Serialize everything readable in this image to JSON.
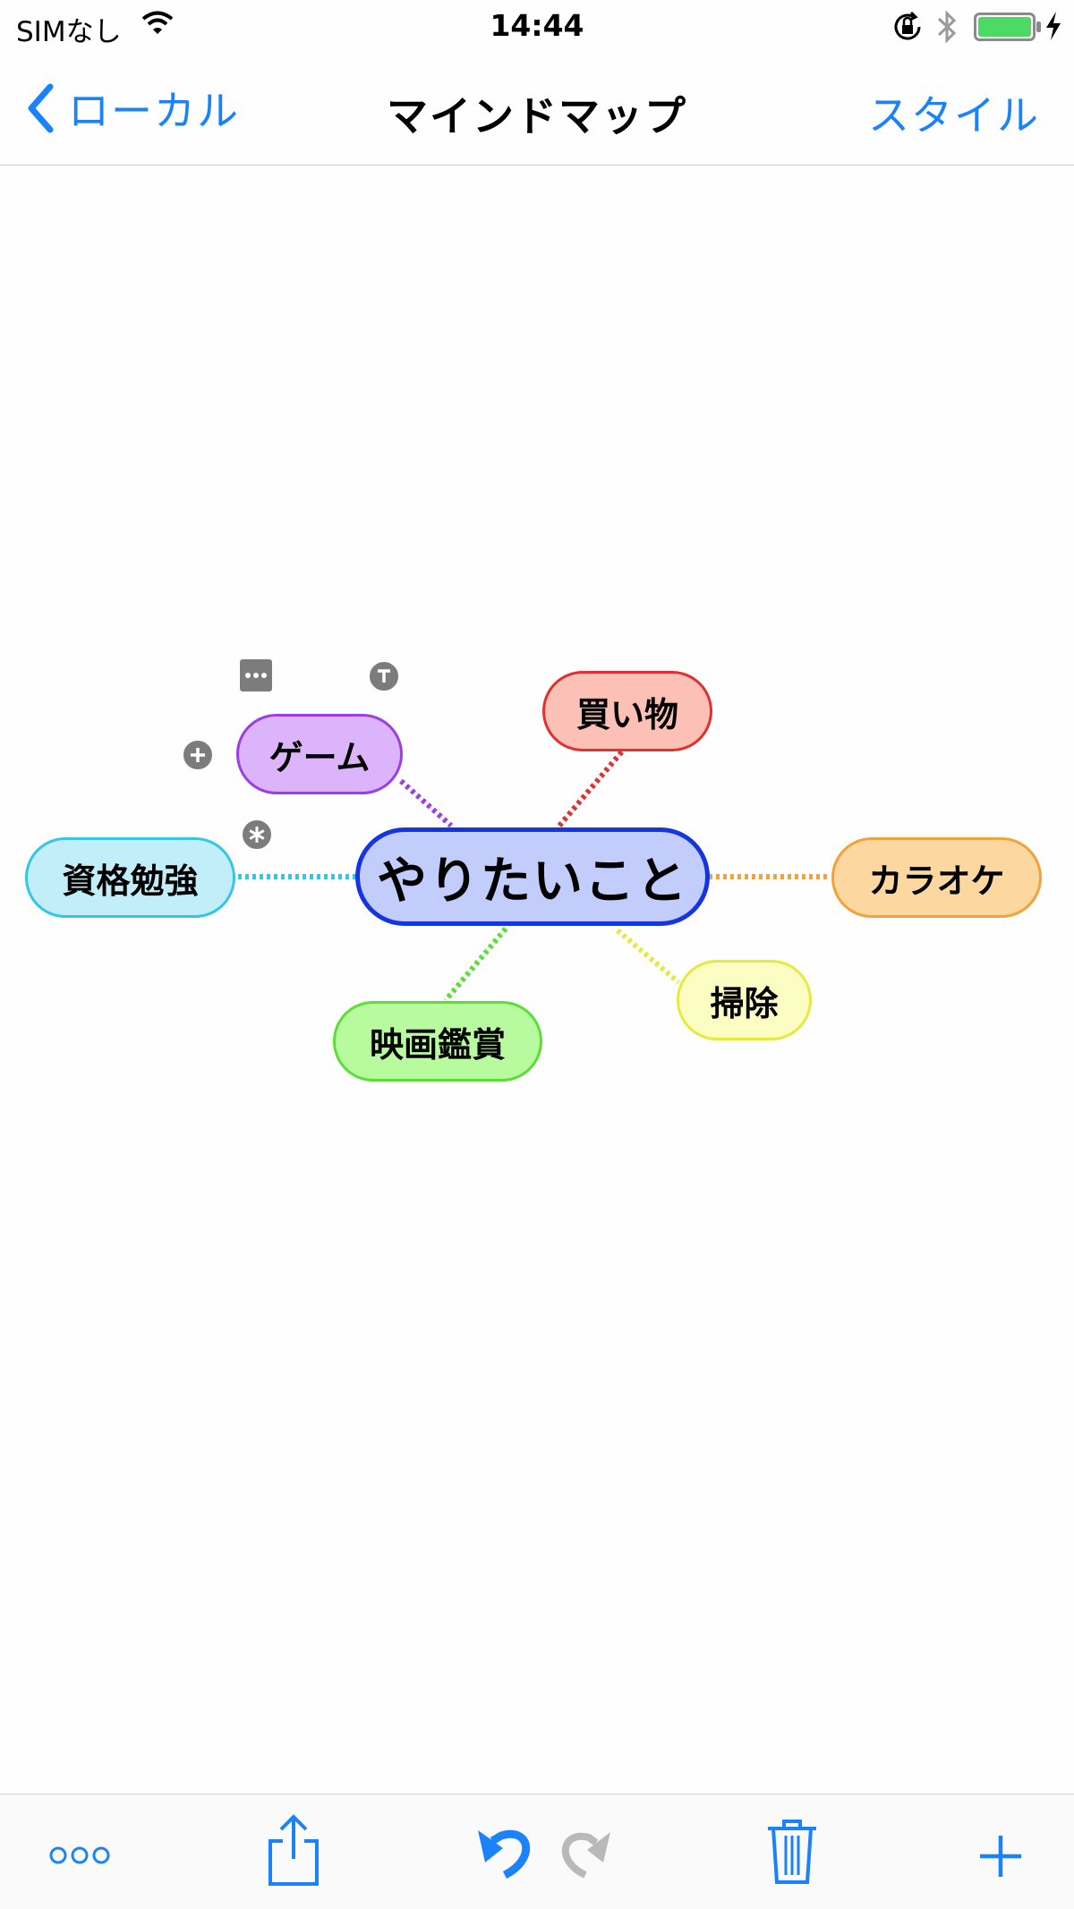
{
  "status_bar": {
    "carrier": "SIMなし",
    "time": "14:44"
  },
  "nav": {
    "back_label": "ローカル",
    "title": "マインドマップ",
    "style_label": "スタイル"
  },
  "mindmap": {
    "root": "やりたいこと",
    "branches": {
      "game": "ゲーム",
      "shopping": "買い物",
      "study": "資格勉強",
      "karaoke": "カラオケ",
      "cleaning": "掃除",
      "movies": "映画鑑賞"
    },
    "selected_branch": "ゲーム"
  },
  "colors": {
    "accent": "#1a82fb",
    "root": "#c3cdfb",
    "game": "#dcb4fb",
    "shopping": "#fcc0b6",
    "study": "#c2eef9",
    "karaoke": "#fdd7a0",
    "cleaning": "#fbfdc3",
    "movies": "#b8fb9e"
  },
  "icons": {
    "back": "chevron-left-icon",
    "more": "more-icon",
    "share": "share-icon",
    "undo": "undo-icon",
    "redo": "redo-icon",
    "delete": "trash-icon",
    "add": "plus-icon"
  }
}
